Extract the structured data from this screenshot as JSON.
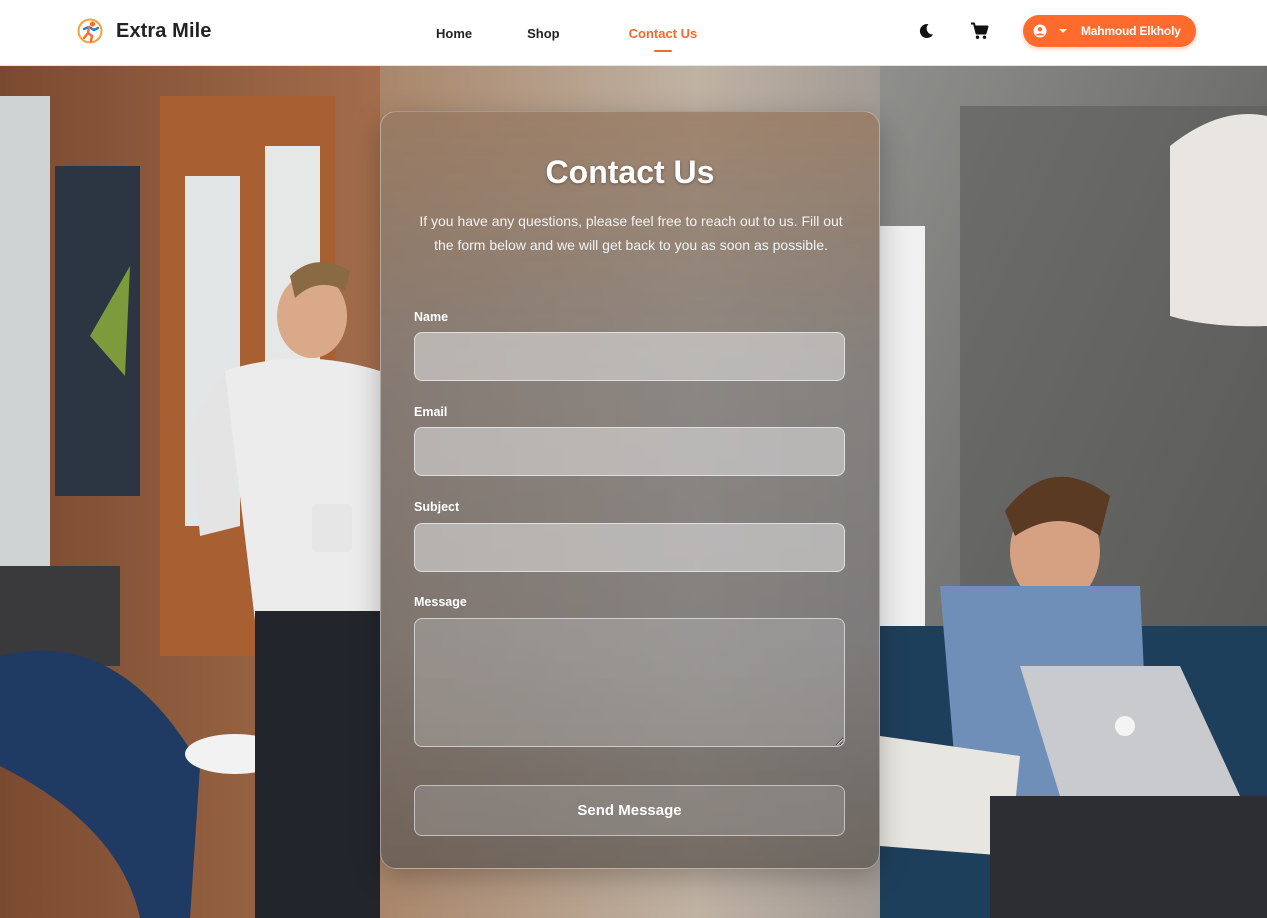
{
  "brand": {
    "name": "Extra Mile",
    "logo_icon": "running-figure-icon"
  },
  "nav": {
    "links": [
      {
        "label": "Home",
        "active": false
      },
      {
        "label": "Shop",
        "active": false
      },
      {
        "label": "Contact Us",
        "active": true
      }
    ],
    "theme_icon": "moon-icon",
    "cart_icon": "cart-icon",
    "user": {
      "name": "Mahmoud Elkholy",
      "avatar_icon": "user-circle-icon",
      "dropdown_icon": "caret-down-icon"
    }
  },
  "contact": {
    "title": "Contact Us",
    "description": "If you have any questions, please feel free to reach out to us. Fill out the form below and we will get back to you as soon as possible.",
    "fields": {
      "name": {
        "label": "Name",
        "value": ""
      },
      "email": {
        "label": "Email",
        "value": ""
      },
      "subject": {
        "label": "Subject",
        "value": ""
      },
      "message": {
        "label": "Message",
        "value": ""
      }
    },
    "submit_label": "Send Message"
  },
  "colors": {
    "accent": "#FF6B2C",
    "nav_bg": "#FFFFFF",
    "text_dark": "#222222"
  }
}
